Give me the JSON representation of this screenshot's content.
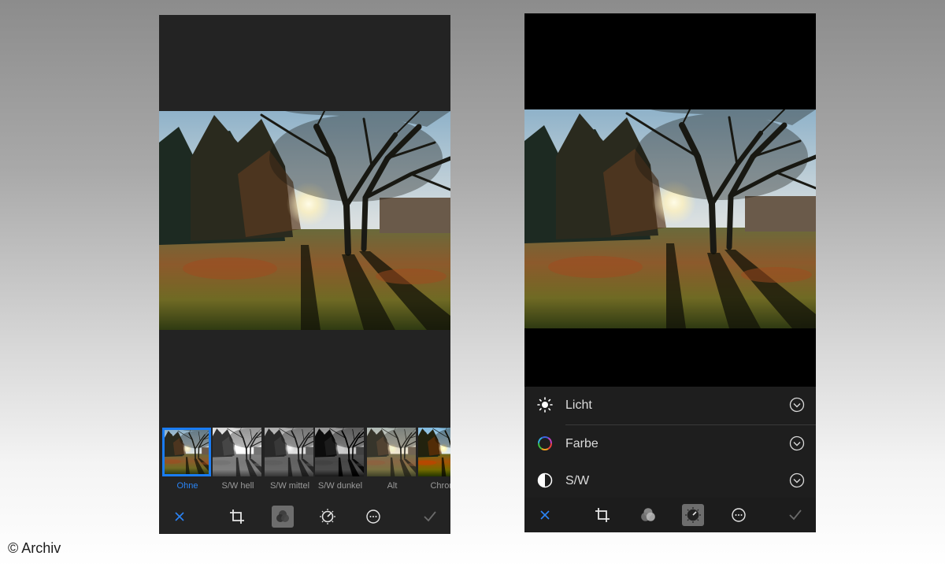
{
  "left_screen": {
    "filters": [
      {
        "label": "Ohne",
        "selected": true
      },
      {
        "label": "S/W hell",
        "selected": false
      },
      {
        "label": "S/W mittel",
        "selected": false
      },
      {
        "label": "S/W dunkel",
        "selected": false
      },
      {
        "label": "Alt",
        "selected": false
      },
      {
        "label": "Chrom",
        "selected": false
      }
    ],
    "toolbar": {
      "cancel_icon": "close-icon",
      "crop_icon": "crop-icon",
      "filter_icon": "filters-icon",
      "adjust_icon": "adjust-dial-icon",
      "more_icon": "more-icon",
      "done_icon": "checkmark-icon",
      "active_tool": "filters"
    }
  },
  "right_screen": {
    "adjust_items": [
      {
        "label": "Licht",
        "icon": "sun-icon"
      },
      {
        "label": "Farbe",
        "icon": "color-wheel-icon"
      },
      {
        "label": "S/W",
        "icon": "half-circle-icon"
      }
    ],
    "toolbar": {
      "active_tool": "adjust"
    }
  },
  "colors": {
    "accent": "#1a7cf2",
    "left_background": "#232323",
    "right_background": "#000000"
  },
  "copyright": "© Archiv"
}
